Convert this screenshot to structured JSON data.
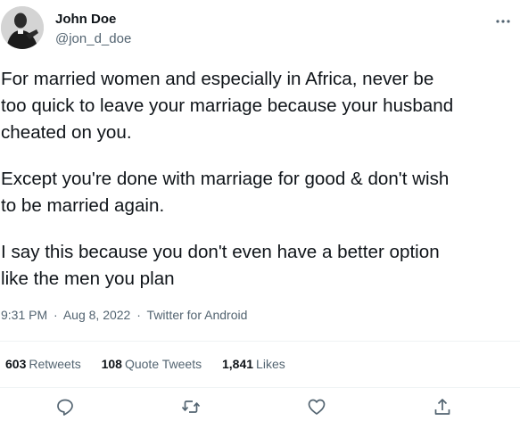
{
  "author": {
    "name": "John Doe",
    "handle": "@jon_d_doe"
  },
  "tweet": {
    "paragraphs": [
      "For married women and especially in Africa, never be\ntoo quick to leave your marriage because your husband\ncheated on you.",
      "Except you're done with marriage for good & don't wish\nto be married again.",
      "I say this because you don't even have a better option\nlike the men you plan"
    ]
  },
  "meta": {
    "time": "9:31 PM",
    "sep1": "·",
    "date": "Aug 8, 2022",
    "sep2": "·",
    "client": "Twitter for Android"
  },
  "stats": {
    "retweets_count": "603",
    "retweets_label": "Retweets",
    "quotes_count": "108",
    "quotes_label": "Quote Tweets",
    "likes_count": "1,841",
    "likes_label": "Likes"
  },
  "icons": {
    "more": "more-horizontal-icon",
    "reply": "reply-icon",
    "retweet": "retweet-icon",
    "like": "like-icon",
    "share": "share-icon"
  },
  "colors": {
    "text_primary": "#0f1419",
    "text_secondary": "#536471",
    "divider": "#eff3f4"
  }
}
